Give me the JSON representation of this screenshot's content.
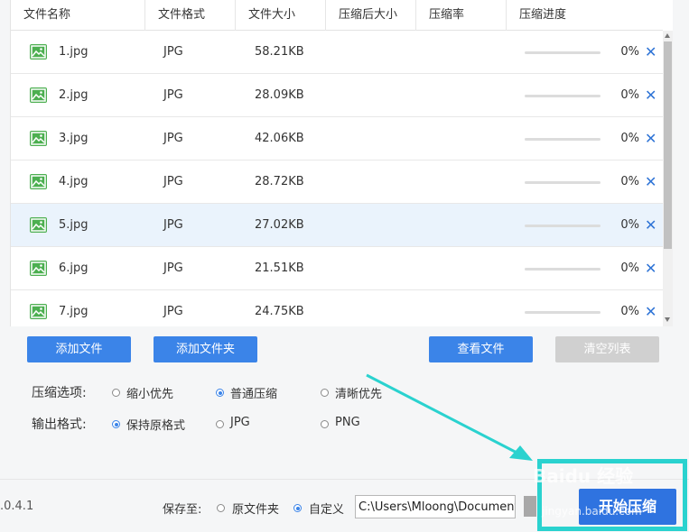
{
  "table": {
    "headers": [
      "文件名称",
      "文件格式",
      "文件大小",
      "压缩后大小",
      "压缩率",
      "压缩进度"
    ],
    "rows": [
      {
        "name": "1.jpg",
        "format": "JPG",
        "size": "58.21KB",
        "progress_text": "0%",
        "progress": 0
      },
      {
        "name": "2.jpg",
        "format": "JPG",
        "size": "28.09KB",
        "progress_text": "0%",
        "progress": 0
      },
      {
        "name": "3.jpg",
        "format": "JPG",
        "size": "42.06KB",
        "progress_text": "0%",
        "progress": 0
      },
      {
        "name": "4.jpg",
        "format": "JPG",
        "size": "28.72KB",
        "progress_text": "0%",
        "progress": 0
      },
      {
        "name": "5.jpg",
        "format": "JPG",
        "size": "27.02KB",
        "progress_text": "0%",
        "progress": 0
      },
      {
        "name": "6.jpg",
        "format": "JPG",
        "size": "21.51KB",
        "progress_text": "0%",
        "progress": 0
      },
      {
        "name": "7.jpg",
        "format": "JPG",
        "size": "24.75KB",
        "progress_text": "0%",
        "progress": 0
      }
    ],
    "selected_row": 4,
    "remove_icon": "close-icon",
    "file_icon": "image-icon"
  },
  "buttons": {
    "add_file": "添加文件",
    "add_folder": "添加文件夹",
    "view_files": "查看文件",
    "clear_list": "清空列表"
  },
  "compress_options": {
    "label": "压缩选项:",
    "options": [
      "缩小优先",
      "普通压缩",
      "清晰优先"
    ],
    "selected": "普通压缩"
  },
  "output_format": {
    "label": "输出格式:",
    "options": [
      "保持原格式",
      "JPG",
      "PNG"
    ],
    "selected": "保持原格式"
  },
  "footer": {
    "version": ".0.4.1",
    "save_to_label": "保存至:",
    "save_options": [
      "原文件夹",
      "自定义"
    ],
    "save_selected": "自定义",
    "path_value": "C:\\Users\\Mloong\\Documents",
    "start_label": "开始压缩"
  },
  "watermark": {
    "text": "Baidu 经验",
    "sub": "jingyan.baidu.com"
  },
  "colors": {
    "accent": "#3b84e8",
    "highlight": "#2ad2cf",
    "icon_green": "#4caf50",
    "selected_row": "#eaf3fc"
  }
}
